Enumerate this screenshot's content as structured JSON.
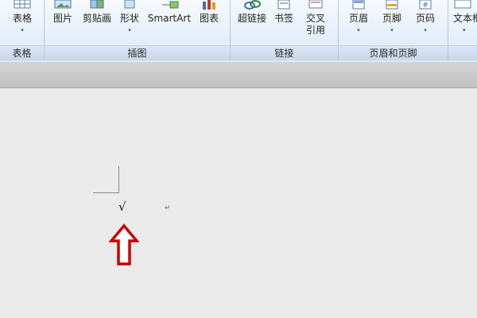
{
  "ribbon": {
    "groups": [
      {
        "label": "表格",
        "buttons": [
          {
            "label": "表格",
            "icon": "table-icon",
            "dropdown": true
          }
        ]
      },
      {
        "label": "插图",
        "buttons": [
          {
            "label": "图片",
            "icon": "picture-icon"
          },
          {
            "label": "剪贴画",
            "icon": "clipart-icon"
          },
          {
            "label": "形状",
            "icon": "shapes-icon",
            "dropdown": true
          },
          {
            "label": "SmartArt",
            "icon": "smartart-icon"
          },
          {
            "label": "图表",
            "icon": "chart-icon"
          }
        ]
      },
      {
        "label": "链接",
        "buttons": [
          {
            "label": "超链接",
            "icon": "hyperlink-icon"
          },
          {
            "label": "书签",
            "icon": "bookmark-icon"
          },
          {
            "label": "交叉",
            "label2": "引用",
            "icon": "cross-reference-icon"
          }
        ]
      },
      {
        "label": "页眉和页脚",
        "buttons": [
          {
            "label": "页眉",
            "icon": "header-icon",
            "dropdown": true
          },
          {
            "label": "页脚",
            "icon": "footer-icon",
            "dropdown": true
          },
          {
            "label": "页码",
            "icon": "page-number-icon",
            "dropdown": true
          }
        ]
      },
      {
        "label": "",
        "buttons": [
          {
            "label": "文本框",
            "icon": "textbox-icon",
            "dropdown": true
          }
        ]
      }
    ],
    "dropdown_glyph": "▾"
  },
  "document": {
    "checkmark": "√",
    "paragraph_mark": "↵",
    "arrow_color": "#cc0000"
  }
}
